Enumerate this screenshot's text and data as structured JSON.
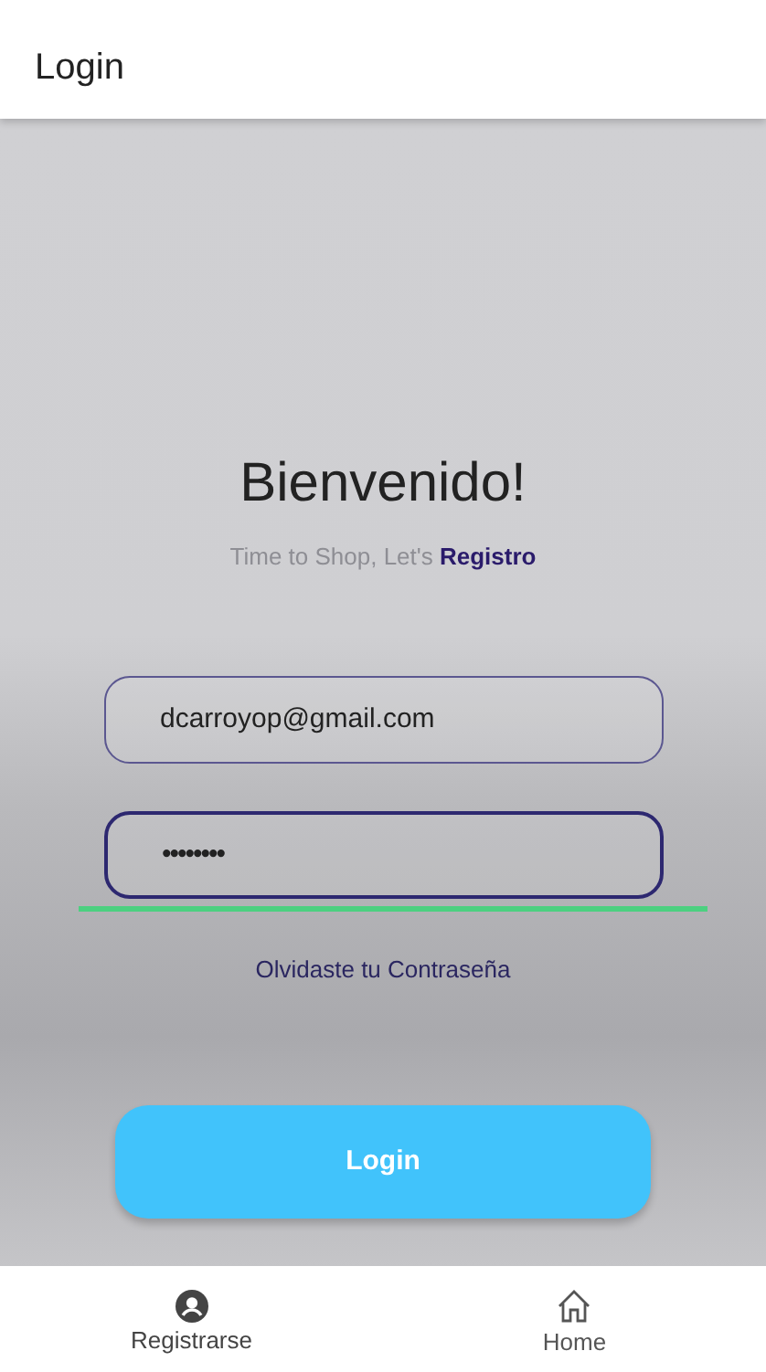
{
  "app_bar": {
    "title": "Login"
  },
  "heading": "Bienvenido!",
  "subtitle": {
    "text": "Time to Shop, Let's",
    "link": "Registro"
  },
  "fields": [
    {
      "kind": "email",
      "value": "dcarroyop@gmail.com",
      "focused": false
    },
    {
      "kind": "password",
      "value": "••••••••",
      "focused": true
    }
  ],
  "forgot_link": "Olvidaste tu Contraseña",
  "login_button": "Login",
  "bottom_nav": [
    {
      "kind": "person",
      "label": "Registrarse",
      "selected": true
    },
    {
      "kind": "home",
      "label": "Home",
      "selected": false
    }
  ]
}
